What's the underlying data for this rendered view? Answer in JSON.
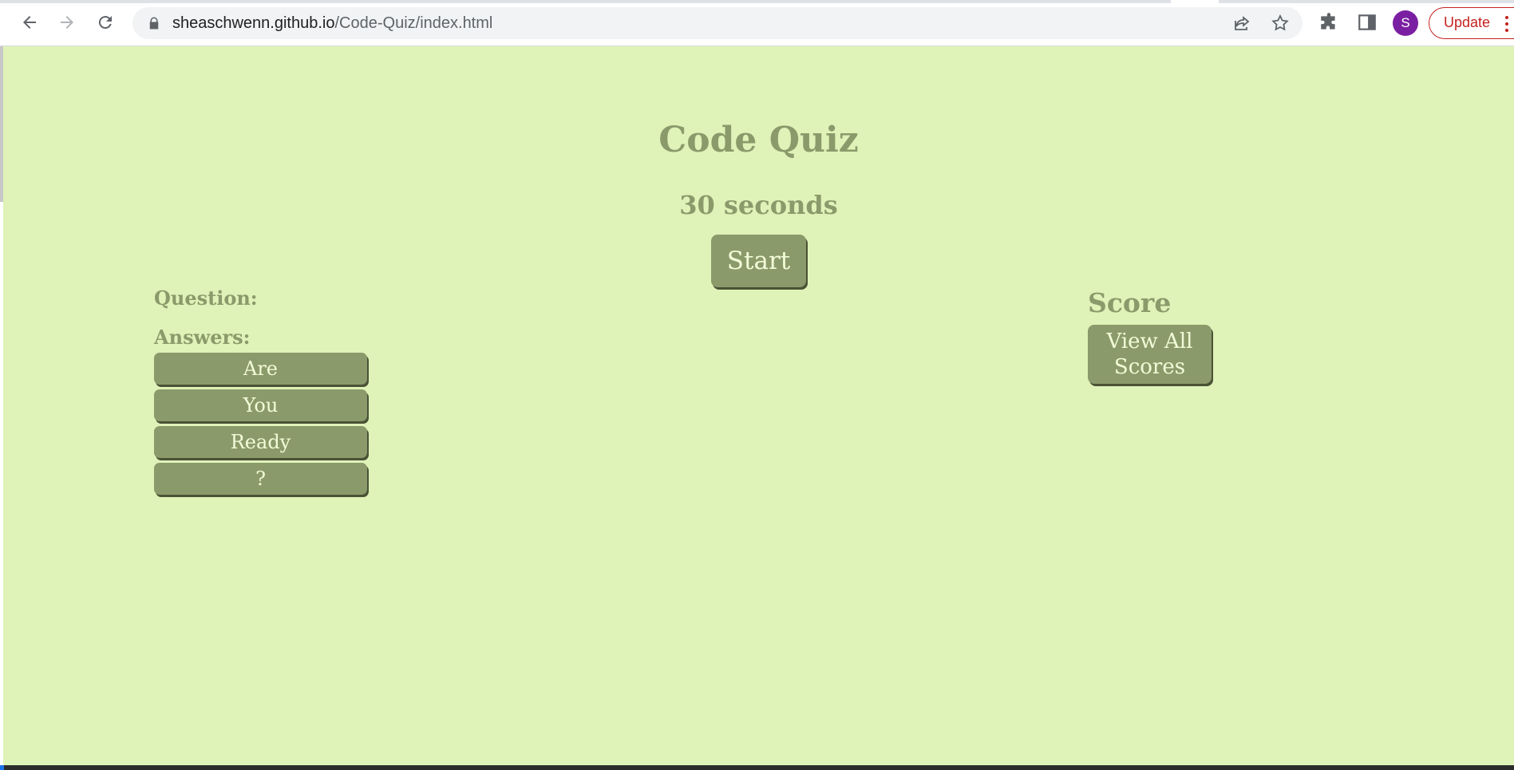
{
  "browser": {
    "url_host": "sheaschwenn.github.io",
    "url_path": "/Code-Quiz/index.html",
    "profile_initial": "S",
    "update_label": "Update",
    "colors": {
      "profile": "#7b1fa2",
      "update": "#c5221f"
    }
  },
  "page": {
    "title": "Code Quiz",
    "timer": "30 seconds",
    "start_label": "Start",
    "question_label": "Question:",
    "answers_label": "Answers:",
    "answers": [
      "Are",
      "You",
      "Ready",
      "?"
    ],
    "score_label": "Score",
    "view_scores_label": "View All Scores",
    "colors": {
      "background": "#dff2b8",
      "accent": "#8b9a6a",
      "button_text": "#f2fbd8"
    }
  }
}
